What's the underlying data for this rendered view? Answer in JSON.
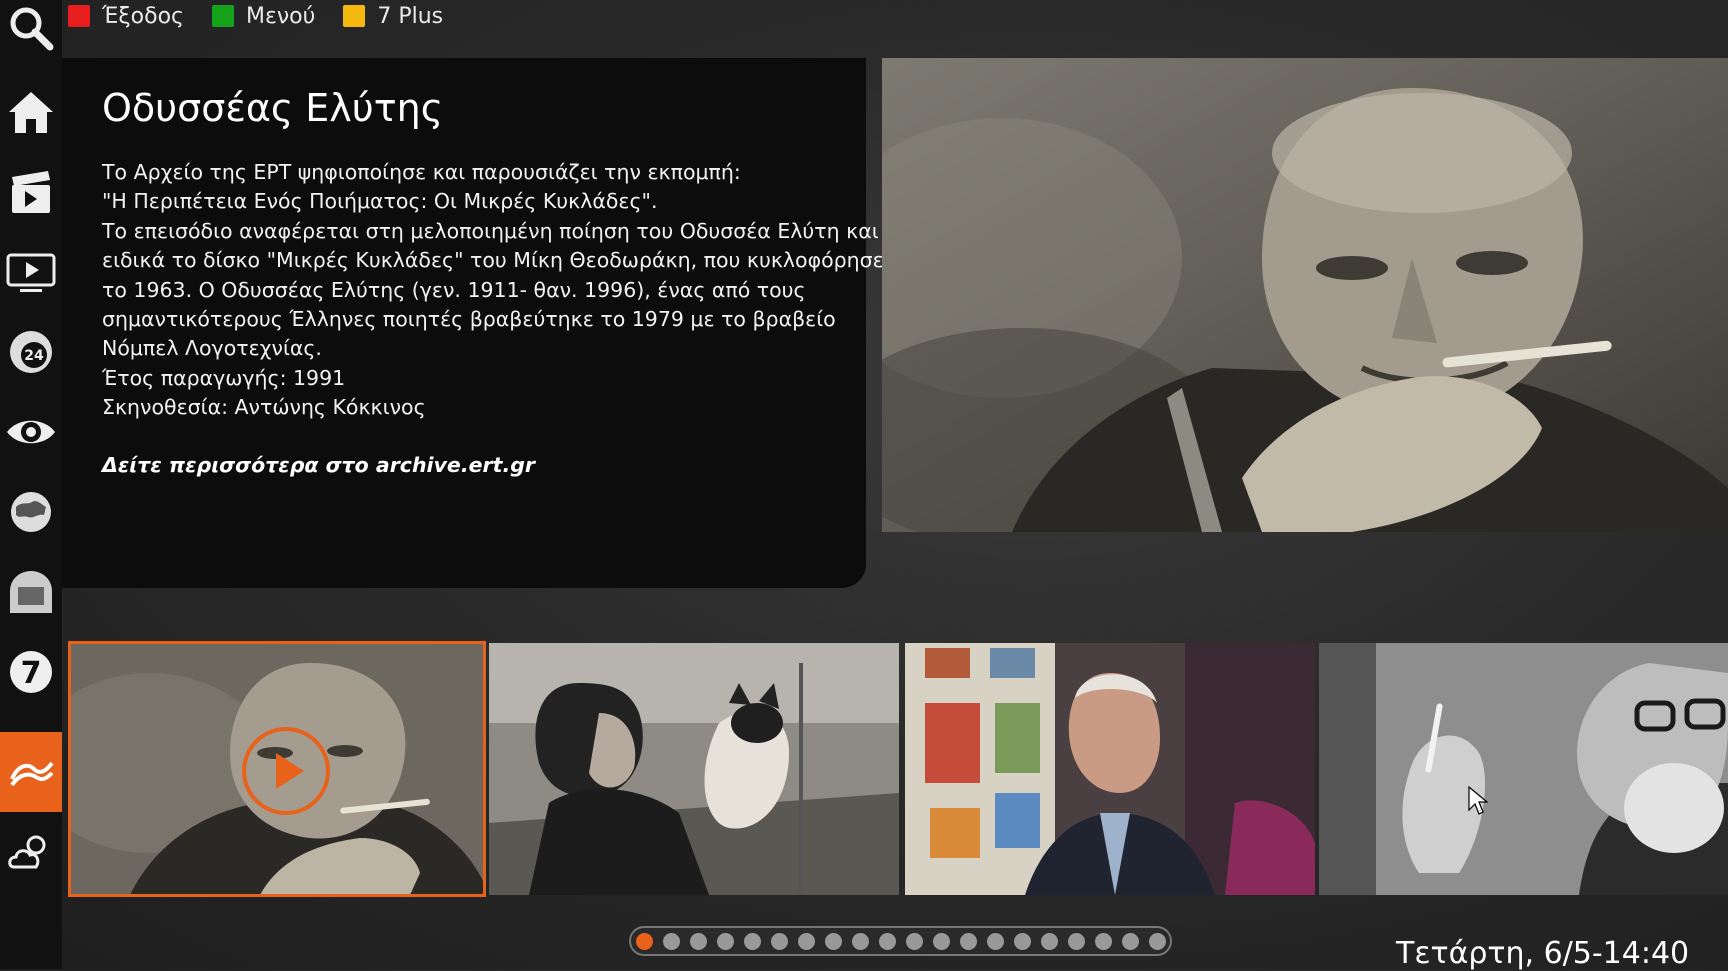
{
  "topbar": {
    "items": [
      {
        "label": "Έξοδος",
        "color": "#e81e1e"
      },
      {
        "label": "Μενού",
        "color": "#15a31c"
      },
      {
        "label": "7 Plus",
        "color": "#f5b80f"
      }
    ]
  },
  "sidebar": {
    "items": [
      "search-icon",
      "home-icon",
      "movies-icon",
      "video-player-icon",
      "ert24-icon",
      "eye-icon",
      "world-icon",
      "archive-icon",
      "channel-7-icon",
      "ert-archive-icon",
      "weather-icon"
    ],
    "active_item": "ert-archive-icon",
    "accent_color": "#e8621c"
  },
  "info": {
    "title": "Οδυσσέας Ελύτης",
    "description": [
      "Το Αρχείο της ΕΡΤ ψηφιοποίησε και παρουσιάζει την εκπομπή:",
      "\"Η Περιπέτεια Ενός Ποιήματος: Οι Μικρές Κυκλάδες\".",
      "Το επεισόδιο αναφέρεται στη μελοποιημένη ποίηση του Οδυσσέα Ελύτη και",
      "ειδικά το δίσκο \"Μικρές Κυκλάδες\" του Μίκη Θεοδωράκη, που κυκλοφόρησε",
      "το 1963. Ο Οδυσσέας Ελύτης (γεν. 1911- θαν. 1996), ένας από τους",
      "σημαντικότερους Έλληνες ποιητές βραβεύτηκε το 1979 με το βραβείο",
      "Νόμπελ Λογοτεχνίας.",
      "Έτος παραγωγής: 1991",
      "Σκηνοθεσία: Αντώνης Κόκκινος"
    ],
    "more_link": "Δείτε περισσότερα στο archive.ert.gr"
  },
  "carousel": {
    "selected_index": 0,
    "thumbnails": [
      "man-smoking-thumbnail",
      "woman-with-cat-thumbnail",
      "man-interview-thumbnail",
      "bearded-man-thumbnail"
    ]
  },
  "pager": {
    "count": 20,
    "active": 0
  },
  "status": {
    "datetime": "Τετάρτη, 6/5-14:40"
  }
}
